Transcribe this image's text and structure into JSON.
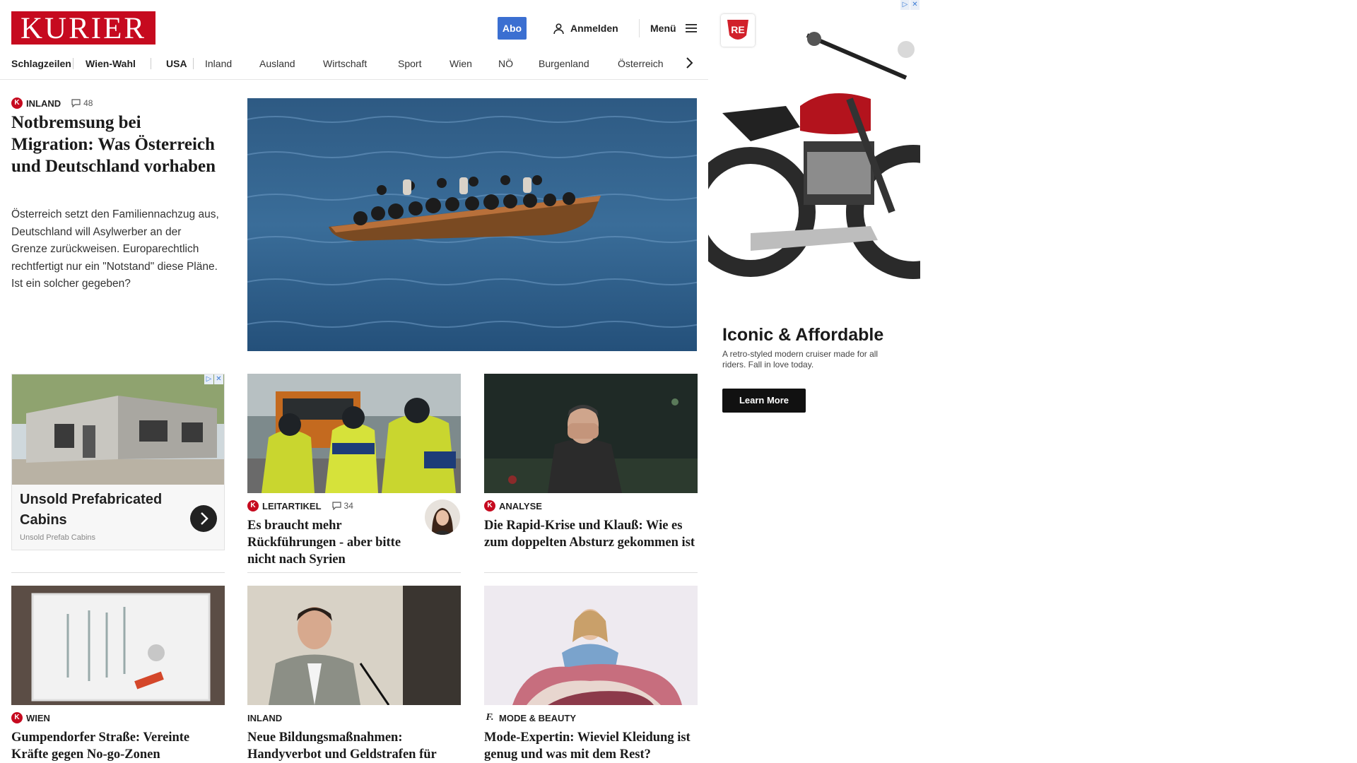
{
  "header": {
    "logo": "KURIER",
    "abo_label": "Abo",
    "login_label": "Anmelden",
    "menu_label": "Menü"
  },
  "nav": {
    "items": [
      "Schlagzeilen",
      "Wien-Wahl",
      "USA",
      "Inland",
      "Ausland",
      "Wirtschaft",
      "Sport",
      "Wien",
      "NÖ",
      "Burgenland",
      "Österreich"
    ]
  },
  "lead": {
    "category": "INLAND",
    "comments": "48",
    "title": "Notbremsung bei Migration: Was Österreich und Deutschland vorhaben",
    "teaser": "Österreich setzt den Familiennachzug aus, Deutschland will Asylwerber an der Grenze zurückweisen. Europarechtlich rechtfertigt nur ein \"Notstand\" diese Pläne. Ist ein solcher gegeben?"
  },
  "ad_cabins": {
    "title": "Unsold Prefabricated Cabins",
    "source": "Unsold Prefab Cabins"
  },
  "cards": [
    {
      "category": "LEITARTIKEL",
      "comments": "34",
      "title": "Es braucht mehr Rückführungen - aber bitte nicht nach Syrien"
    },
    {
      "category": "ANALYSE",
      "title": "Die Rapid-Krise und Klauß: Wie es zum doppelten Absturz gekommen ist"
    },
    {
      "category": "WIEN",
      "title": "Gumpendorfer Straße: Vereinte Kräfte gegen No-go-Zonen"
    },
    {
      "category": "INLAND",
      "title": "Neue Bildungsmaßnahmen: Handyverbot und Geldstrafen für Eltern?"
    },
    {
      "category": "MODE & BEAUTY",
      "title": "Mode-Expertin: Wieviel Kleidung ist genug und was mit dem Rest?"
    }
  ],
  "ad_right": {
    "title": "Iconic & Affordable",
    "description": "A retro-styled modern cruiser made for all riders. Fall in love today.",
    "cta": "Learn More",
    "brand_badge": "RE"
  },
  "colors": {
    "brand_red": "#c60a1f",
    "abo_blue": "#3b6fd1"
  }
}
